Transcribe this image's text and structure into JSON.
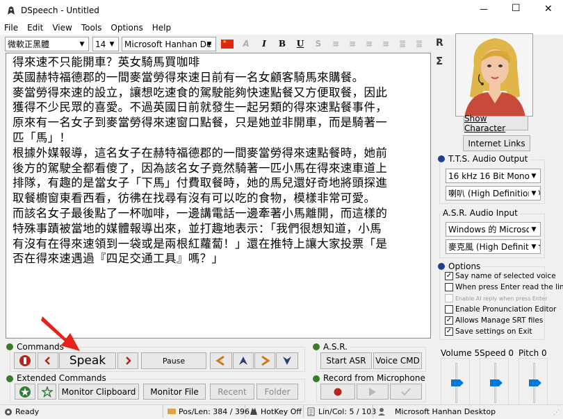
{
  "window": {
    "title": "DSpeech - Untitled",
    "minimize": "—",
    "maximize": "☐",
    "close": "✕"
  },
  "menu": [
    "File",
    "Edit",
    "View",
    "Tools",
    "Options",
    "Help"
  ],
  "toolbar": {
    "script_font": "微軟正黑體",
    "font_size": "14",
    "voice": "Microsoft Hanhan De",
    "bold": "B",
    "italic": "I",
    "underline": "U"
  },
  "side_icons": {
    "r_label": "R",
    "sigma_label": "Σ"
  },
  "editor_lines": [
    "得來速不只能開車？英女騎馬買咖啡",
    "英國赫特福德郡的一間麥當勞得來速日前有一名女顧客騎馬來購餐。",
    "麥當勞得來速的設立，讓想吃速食的駕駛能夠快速點餐又方便取餐，因此",
    "獲得不少民眾的喜愛。不過英國日前就發生一起另類的得來速點餐事件，",
    "原來有一名女子到麥當勞得來速窗口點餐，只是她並非開車，而是騎著一",
    "匹「馬」！",
    "根據外媒報導，這名女子在赫特福德郡的一間麥當勞得來速點餐時，她前",
    "後方的駕駛全都看傻了，因為該名女子竟然騎著一匹小馬在得來速車道上",
    "排隊，有趣的是當女子「下馬」付費取餐時，她的馬兒還好奇地將頭探進",
    "取餐櫥窗東看西看，彷彿在找尋有沒有可以吃的食物，模樣非常可愛。",
    "而該名女子最後點了一杯咖啡，一邊講電話一邊牽著小馬離開，而這樣的",
    "特殊事蹟被當地的媒體報導出來，並打趣地表示：「我們很想知道，小馬",
    "有沒有在得來速領到一袋或是兩根紅蘿蔔！」還在推特上讓大家投票「是",
    "否在得來速遇過『四足交通工具』嗎？」"
  ],
  "character": {
    "show_button": "Show Character",
    "internet_button": "Internet Links"
  },
  "tts": {
    "title": "T.T.S. Audio Output",
    "format": "16 kHz 16 Bit Mono",
    "device": "喇叭 (High Definition Audio"
  },
  "asr_input": {
    "title": "A.S.R. Audio Input",
    "engine": "Windows 的 Microsoft",
    "device": "麥克風 (High Definition"
  },
  "options": {
    "title": "Options",
    "items": [
      {
        "label": "Say name of selected voice",
        "checked": true,
        "enabled": true
      },
      {
        "label": "When press Enter read the line",
        "checked": false,
        "enabled": true
      },
      {
        "label": "Enable AI reply when press Enter",
        "checked": false,
        "enabled": false
      },
      {
        "label": "Enable Pronunciation Editor",
        "checked": false,
        "enabled": true
      },
      {
        "label": "Allows Manage SRT files",
        "checked": true,
        "enabled": true
      },
      {
        "label": "Save settings on Exit",
        "checked": true,
        "enabled": true
      }
    ]
  },
  "sliders": [
    {
      "label": "Volume 5",
      "level": 0.5
    },
    {
      "label": "Speed 0",
      "level": 0.5
    },
    {
      "label": "Pitch 0",
      "level": 0.5
    }
  ],
  "commands": {
    "title": "Commands",
    "speak": "Speak",
    "pause": "Pause"
  },
  "extended": {
    "title": "Extended Commands",
    "monitor_clipboard": "Monitor Clipboard",
    "monitor_file": "Monitor File",
    "recent": "Recent",
    "folder": "Folder"
  },
  "asr": {
    "title": "A.S.R.",
    "start": "Start ASR",
    "voice_cmd": "Voice CMD"
  },
  "record": {
    "title": "Record from Microphone"
  },
  "status": {
    "ready": "Ready",
    "poslen": "Pos/Len: 384 / 396",
    "hotkey": "HotKey Off",
    "lincol": "Lin/Col: 5 / 103",
    "voice": "Microsoft Hanhan Desktop"
  },
  "colors": {
    "accent": "#0078d7",
    "arrow": "#e8221b",
    "flag": "#de2910",
    "speaker_bg": "#c84a3a"
  }
}
